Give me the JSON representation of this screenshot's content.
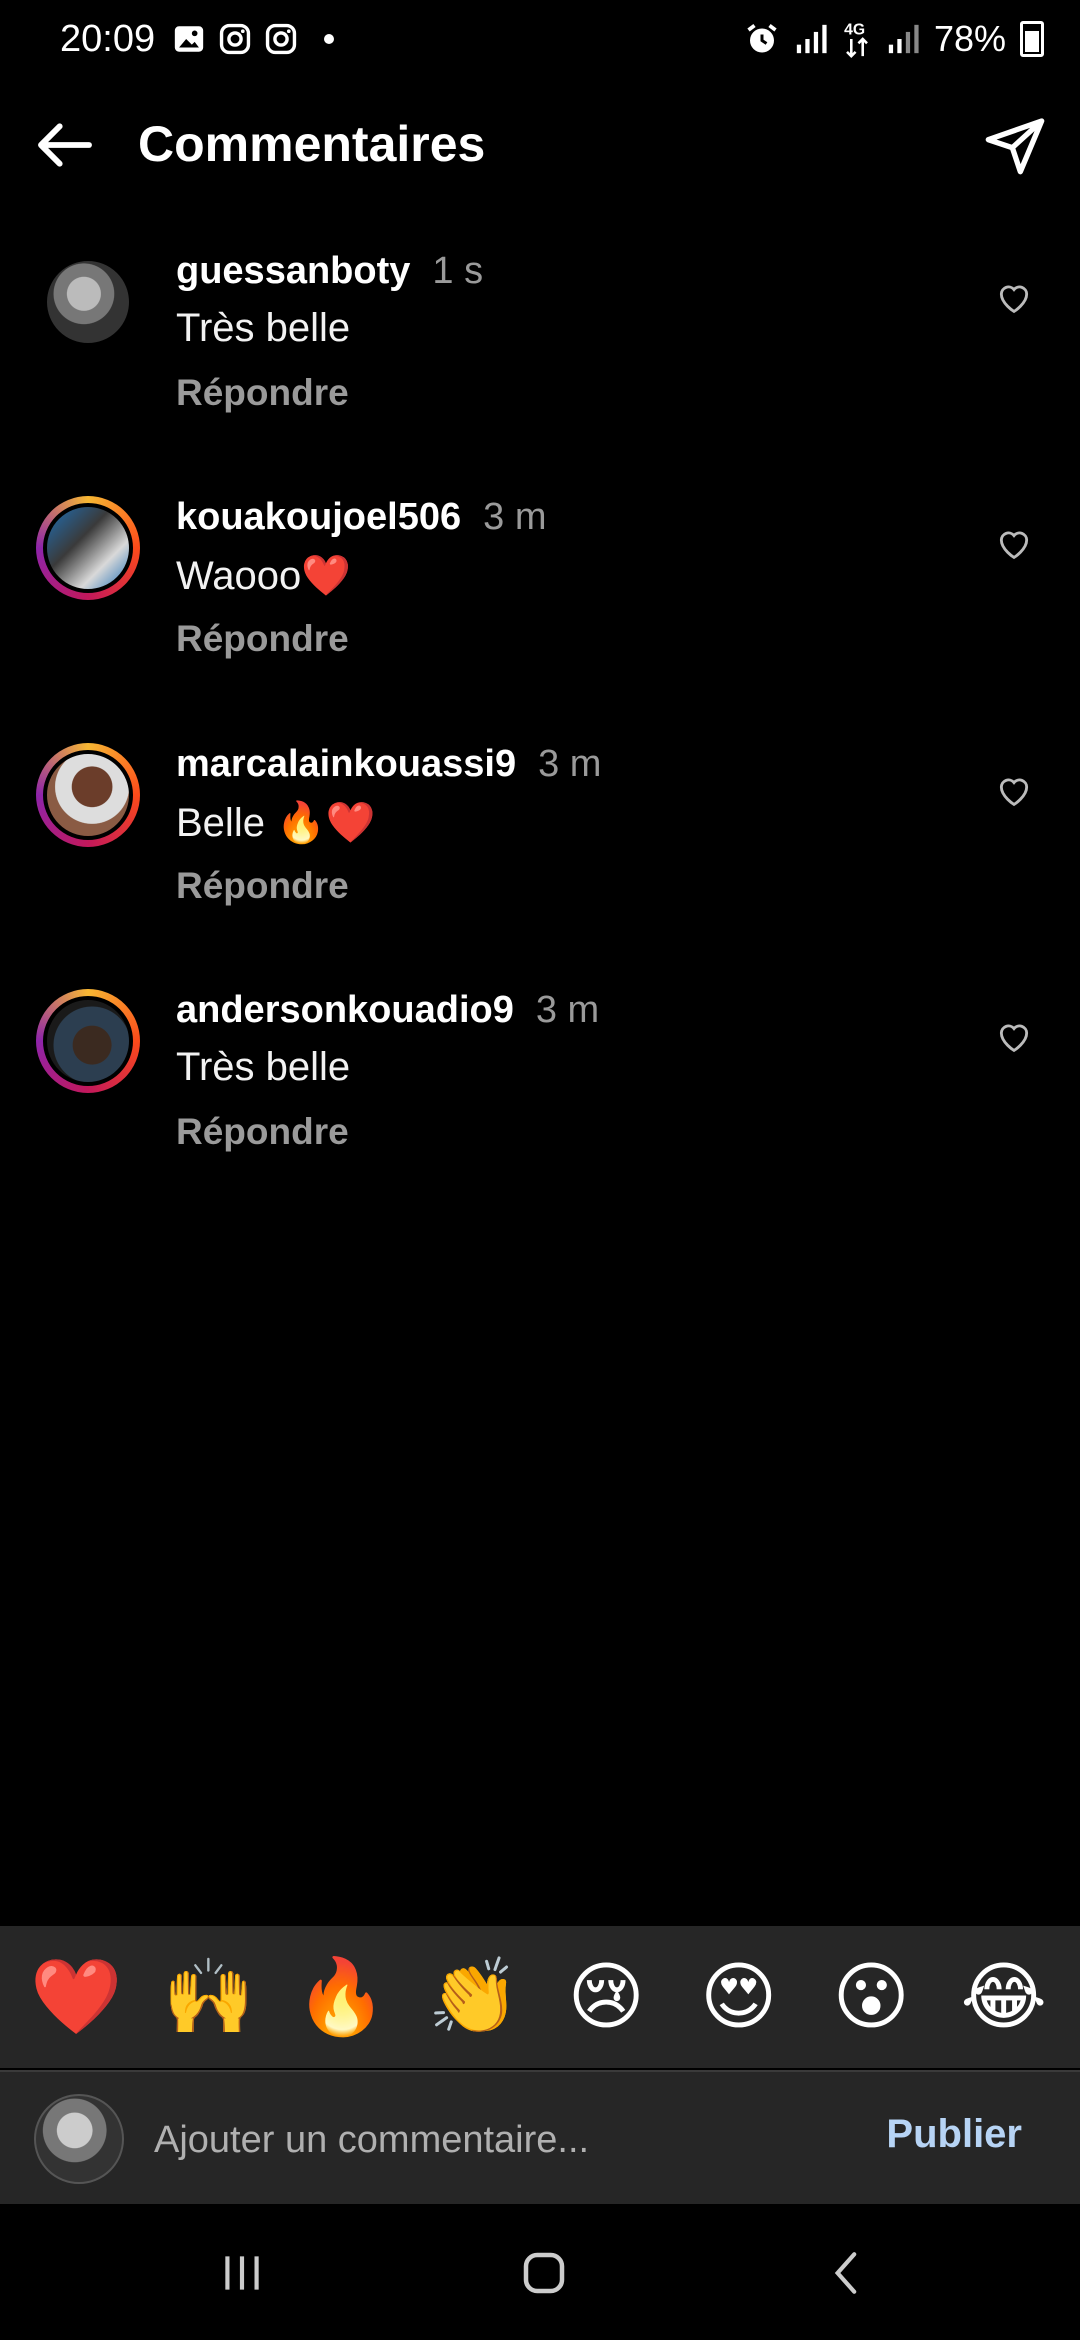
{
  "status_bar": {
    "time": "20:09",
    "left_icons": [
      "gallery-icon",
      "instagram-icon",
      "instagram-icon"
    ],
    "right_icons": [
      "alarm-icon",
      "signal-icon",
      "4g-icon",
      "signal-icon"
    ],
    "battery": "78%"
  },
  "header": {
    "title": "Commentaires",
    "back_icon": "arrow-left-icon",
    "share_icon": "send-icon"
  },
  "comments": [
    {
      "username": "guessanboty",
      "time": "1 s",
      "text": "Très belle",
      "reply": "Répondre",
      "story_ring": false
    },
    {
      "username": "kouakoujoel506",
      "time": "3 m",
      "text": "Waooo❤️",
      "reply": "Répondre",
      "story_ring": true
    },
    {
      "username": "marcalainkouassi9",
      "time": "3 m",
      "text": "Belle 🔥❤️",
      "reply": "Répondre",
      "story_ring": true
    },
    {
      "username": "andersonkouadio9",
      "time": "3 m",
      "text": "Très belle",
      "reply": "Répondre",
      "story_ring": true
    }
  ],
  "emoji_bar": [
    "❤️",
    "🙌",
    "🔥",
    "👏",
    "😢",
    "😍",
    "😮",
    "😂"
  ],
  "composer": {
    "placeholder": "Ajouter un commentaire...",
    "publish_label": "Publier"
  },
  "nav_bar": [
    "recents-icon",
    "home-icon",
    "back-icon"
  ],
  "colors": {
    "background": "#000000",
    "secondary_text": "#9a9a9a",
    "publish": "#b7d4f5",
    "panel": "#262626"
  }
}
